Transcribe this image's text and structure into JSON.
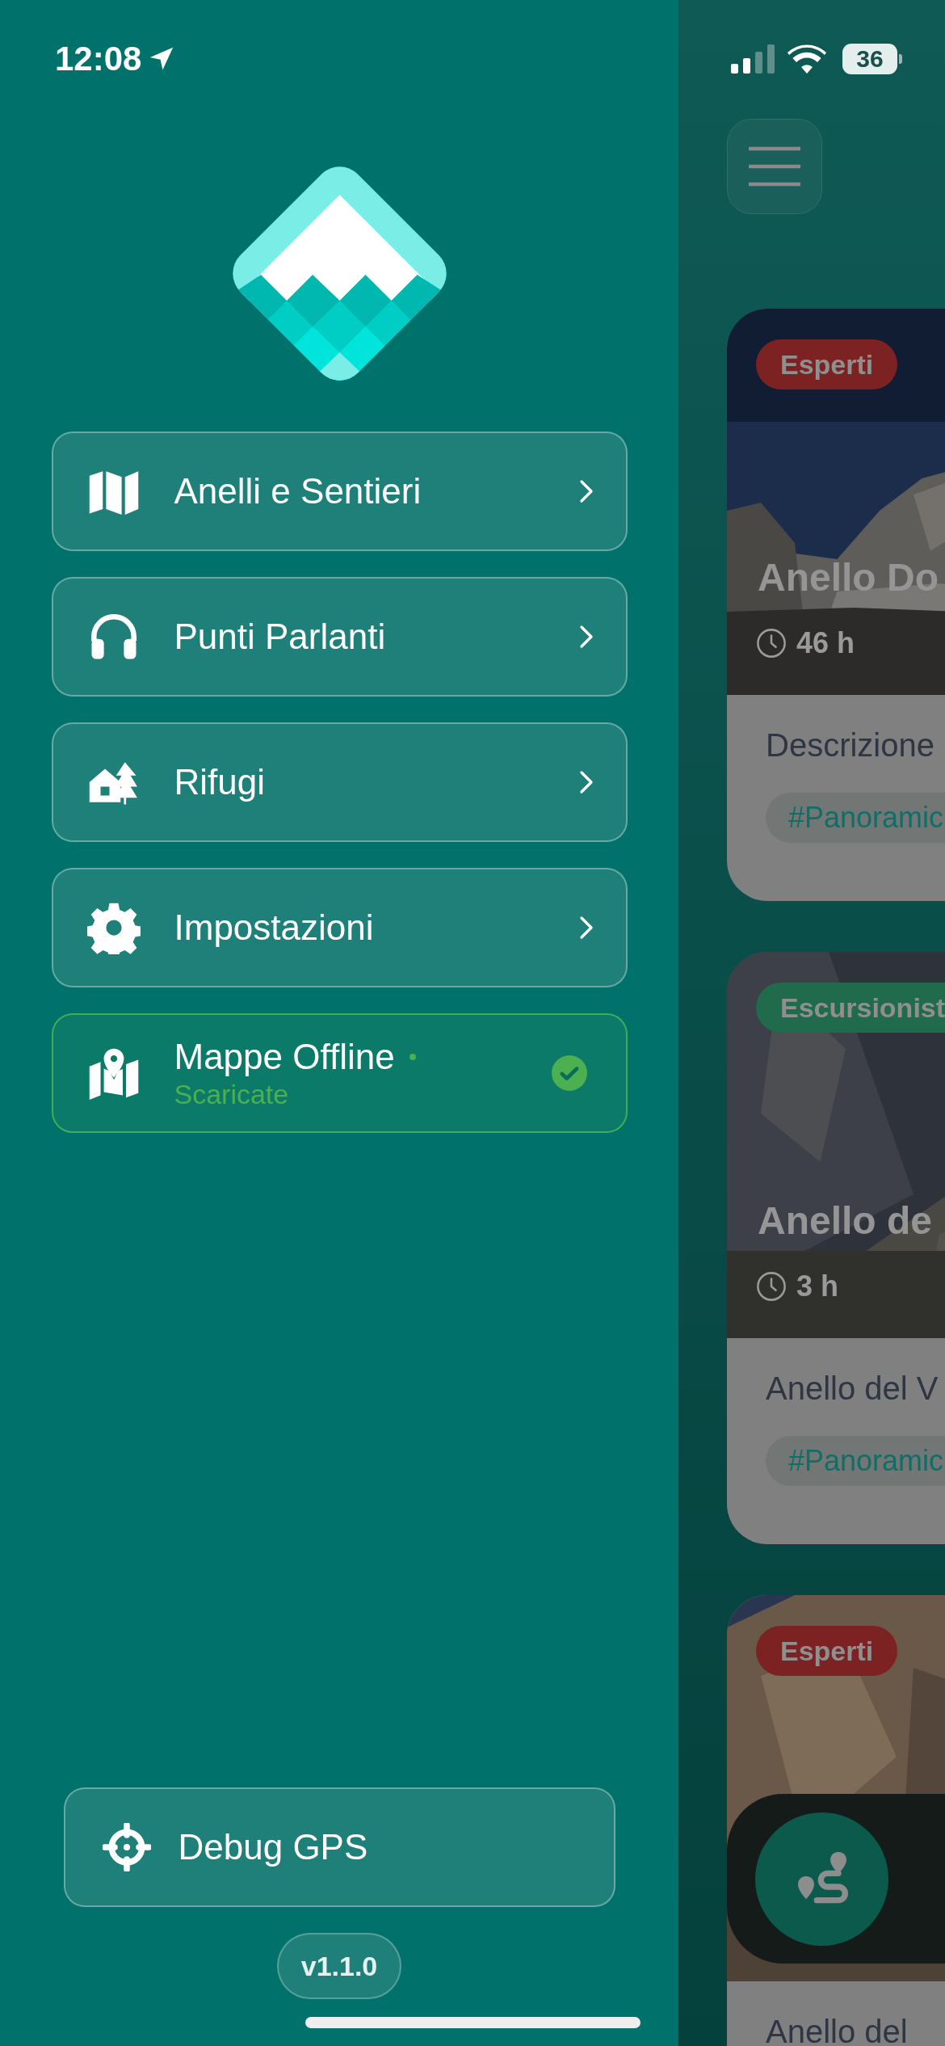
{
  "status_bar": {
    "time": "12:08",
    "battery": "36"
  },
  "menu": [
    {
      "kind": "link",
      "label": "Anelli e Sentieri"
    },
    {
      "kind": "link",
      "label": "Punti Parlanti"
    },
    {
      "kind": "link",
      "label": "Rifugi"
    },
    {
      "kind": "link",
      "label": "Impostazioni"
    },
    {
      "kind": "status",
      "label": "Mappe Offline",
      "status": "Scaricate",
      "downloaded": true
    }
  ],
  "debug_button": {
    "label": "Debug GPS"
  },
  "version": "v1.1.0",
  "trail_cards": [
    {
      "badge": "Esperti",
      "color": "#7d2222",
      "title": "Anello Do",
      "duration": "46 h",
      "description": "Descrizione",
      "tag": "#Panoramic"
    },
    {
      "badge": "Escursionist",
      "color": "#1f6b4b",
      "title": "Anello de",
      "duration": "3 h",
      "description": "Anello del V",
      "tag": "#Panoramic"
    },
    {
      "badge": "Esperti",
      "color": "#7d2222",
      "description": "Anello del"
    }
  ]
}
